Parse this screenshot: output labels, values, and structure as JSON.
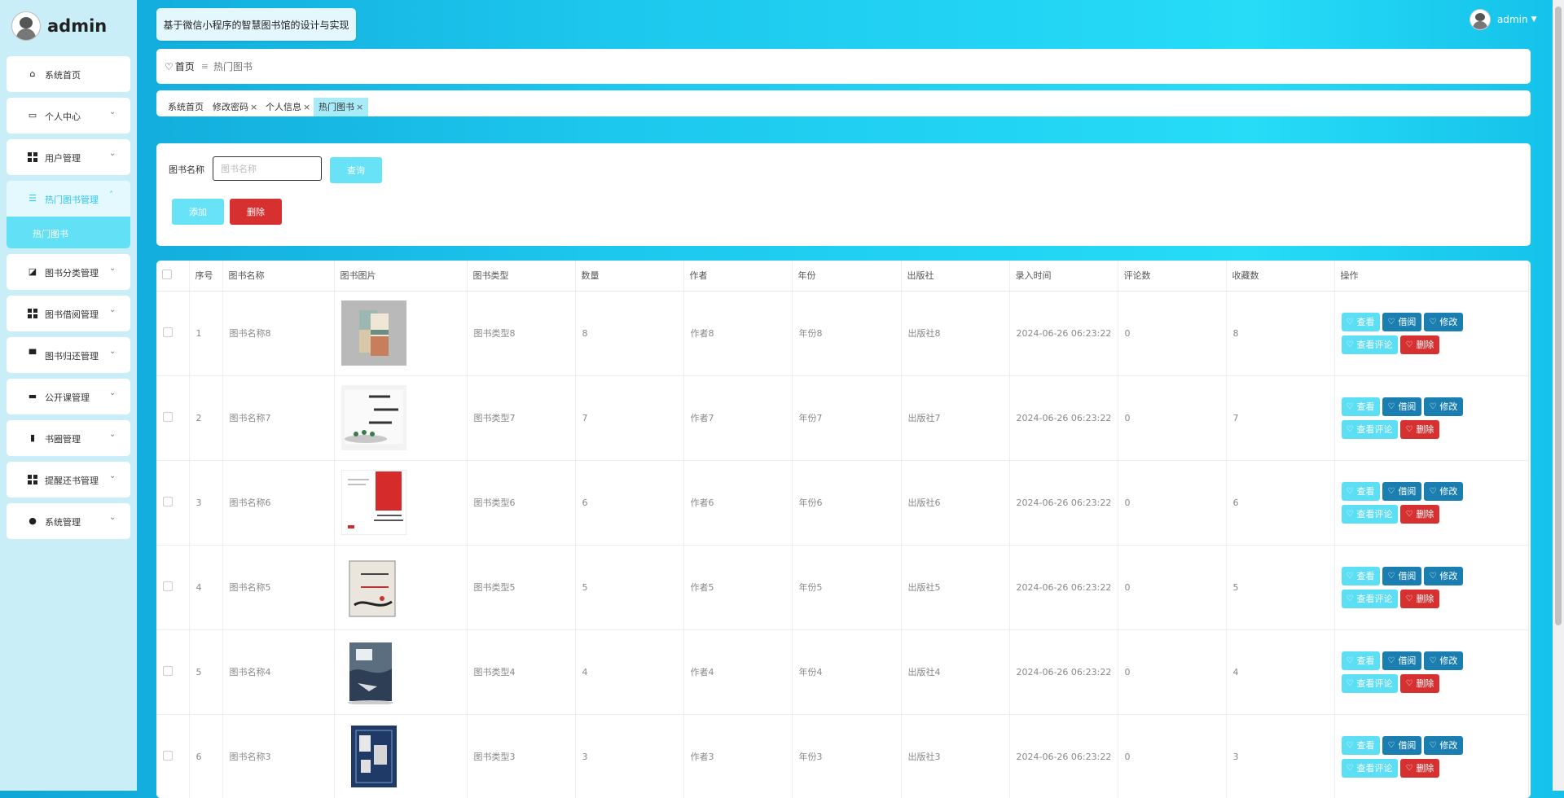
{
  "app": {
    "brand": "admin",
    "title": "基于微信小程序的智慧图书馆的设计与实现"
  },
  "user": {
    "name": "admin"
  },
  "colors": {
    "accent": "#5cdef5",
    "primary": "#1a7fb0",
    "danger": "#d63031",
    "sidebar_bg": "#c9eef8"
  },
  "sidebar": {
    "items": [
      {
        "label": "系统首页",
        "icon": "home-icon"
      },
      {
        "label": "个人中心",
        "icon": "calendar-icon"
      },
      {
        "label": "用户管理",
        "icon": "grid-icon"
      },
      {
        "label": "热门图书管理",
        "icon": "sliders-icon",
        "submenu": [
          "热门图书"
        ]
      },
      {
        "label": "图书分类管理",
        "icon": "chart-icon"
      },
      {
        "label": "图书借阅管理",
        "icon": "grid-icon"
      },
      {
        "label": "图书归还管理",
        "icon": "monitor-icon"
      },
      {
        "label": "公开课管理",
        "icon": "ticket-icon"
      },
      {
        "label": "书圈管理",
        "icon": "bar-chart-icon"
      },
      {
        "label": "提醒还书管理",
        "icon": "grid-icon"
      },
      {
        "label": "系统管理",
        "icon": "globe-icon"
      }
    ]
  },
  "breadcrumb": {
    "home": "首页",
    "sep": "≡",
    "current": "热门图书"
  },
  "tags": [
    "系统首页",
    "修改密码",
    "个人信息",
    "热门图书"
  ],
  "search": {
    "label": "图书名称",
    "placeholder": "图书名称",
    "query_label": "查询",
    "add_label": "添加",
    "delete_label": "删除"
  },
  "table": {
    "headers": [
      "",
      "序号",
      "图书名称",
      "图书图片",
      "图书类型",
      "数量",
      "作者",
      "年份",
      "出版社",
      "录入时间",
      "评论数",
      "收藏数",
      "操作"
    ],
    "actions": {
      "view": "查看",
      "borrow": "借阅",
      "edit": "修改",
      "comment": "查看评论",
      "delete": "删除"
    },
    "rows": [
      {
        "no": "1",
        "name": "图书名称8",
        "type": "图书类型8",
        "qty": "8",
        "author": "作者8",
        "year": "年份8",
        "publisher": "出版社8",
        "time": "2024-06-26 06:23:22",
        "comments": "0",
        "favorites": "8"
      },
      {
        "no": "2",
        "name": "图书名称7",
        "type": "图书类型7",
        "qty": "7",
        "author": "作者7",
        "year": "年份7",
        "publisher": "出版社7",
        "time": "2024-06-26 06:23:22",
        "comments": "0",
        "favorites": "7"
      },
      {
        "no": "3",
        "name": "图书名称6",
        "type": "图书类型6",
        "qty": "6",
        "author": "作者6",
        "year": "年份6",
        "publisher": "出版社6",
        "time": "2024-06-26 06:23:22",
        "comments": "0",
        "favorites": "6"
      },
      {
        "no": "4",
        "name": "图书名称5",
        "type": "图书类型5",
        "qty": "5",
        "author": "作者5",
        "year": "年份5",
        "publisher": "出版社5",
        "time": "2024-06-26 06:23:22",
        "comments": "0",
        "favorites": "5"
      },
      {
        "no": "5",
        "name": "图书名称4",
        "type": "图书类型4",
        "qty": "4",
        "author": "作者4",
        "year": "年份4",
        "publisher": "出版社4",
        "time": "2024-06-26 06:23:22",
        "comments": "0",
        "favorites": "4"
      },
      {
        "no": "6",
        "name": "图书名称3",
        "type": "图书类型3",
        "qty": "3",
        "author": "作者3",
        "year": "年份3",
        "publisher": "出版社3",
        "time": "2024-06-26 06:23:22",
        "comments": "0",
        "favorites": "3"
      }
    ]
  }
}
